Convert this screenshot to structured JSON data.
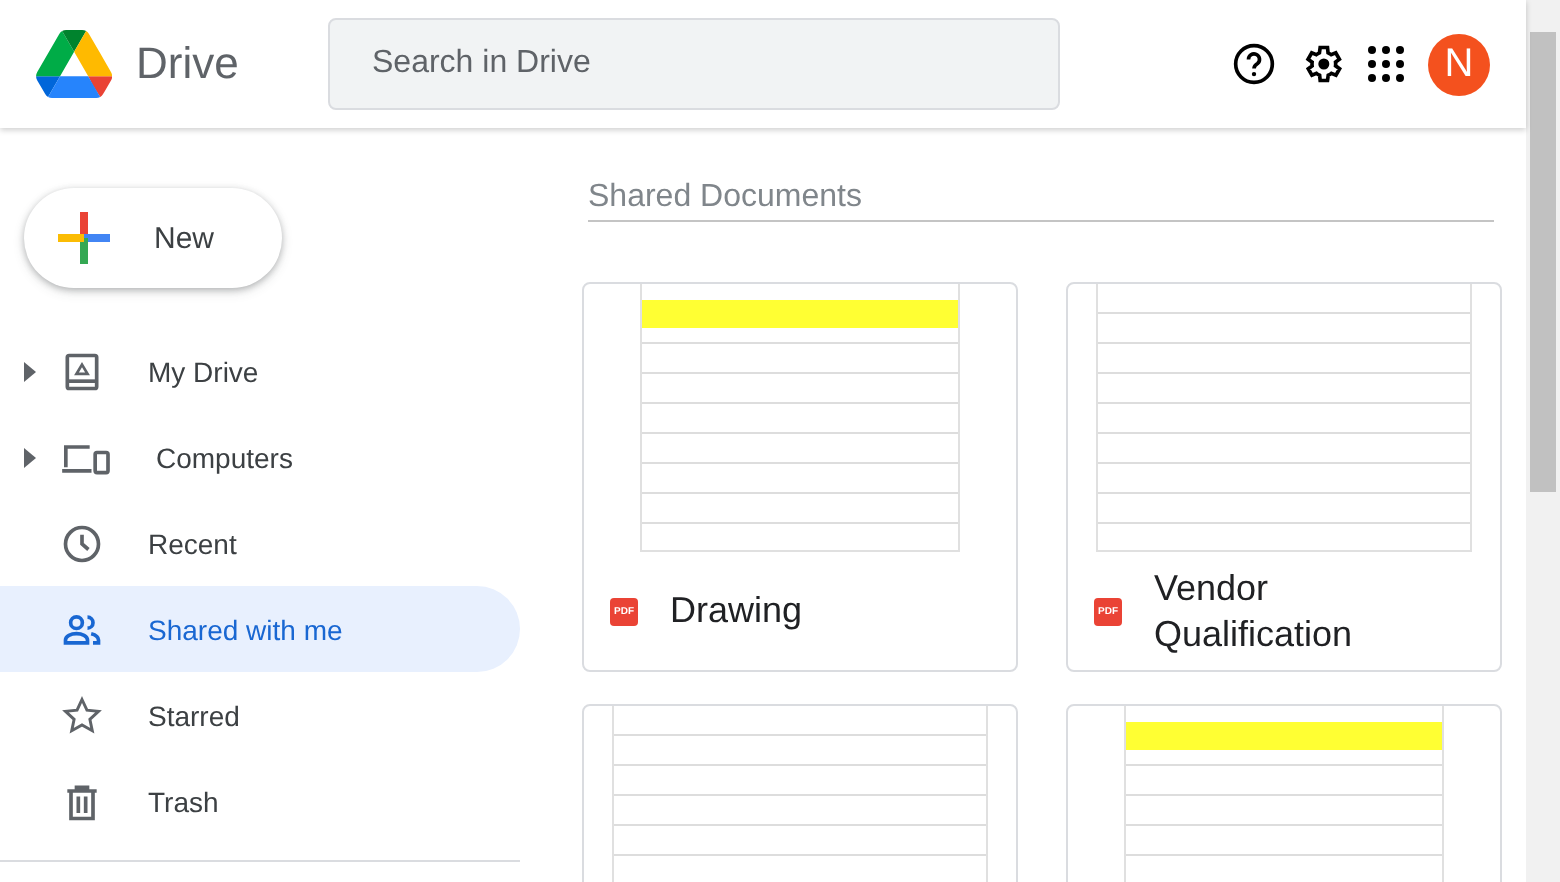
{
  "header": {
    "app_name": "Drive",
    "search": {
      "placeholder": "Search in Drive"
    },
    "avatar": "N"
  },
  "sidebar": {
    "new_button": "New",
    "items": [
      {
        "label": "My Drive",
        "kind": "drive",
        "expandable": true,
        "selected": false
      },
      {
        "label": "Computers",
        "kind": "computers",
        "expandable": true,
        "selected": false
      },
      {
        "label": "Recent",
        "kind": "recent",
        "expandable": false,
        "selected": false
      },
      {
        "label": "Shared with me",
        "kind": "shared",
        "expandable": false,
        "selected": true
      },
      {
        "label": "Starred",
        "kind": "starred",
        "expandable": false,
        "selected": false
      },
      {
        "label": "Trash",
        "kind": "trash",
        "expandable": false,
        "selected": false
      }
    ]
  },
  "main": {
    "heading": "Shared Documents",
    "files": [
      {
        "title": "Drawing",
        "file_type": "PDF",
        "kind": "pricelist"
      },
      {
        "title": "Vendor Qualification",
        "file_type": "PDF",
        "kind": "catalog"
      },
      {
        "kind": "catalog"
      },
      {
        "kind": "pricelist"
      }
    ]
  }
}
